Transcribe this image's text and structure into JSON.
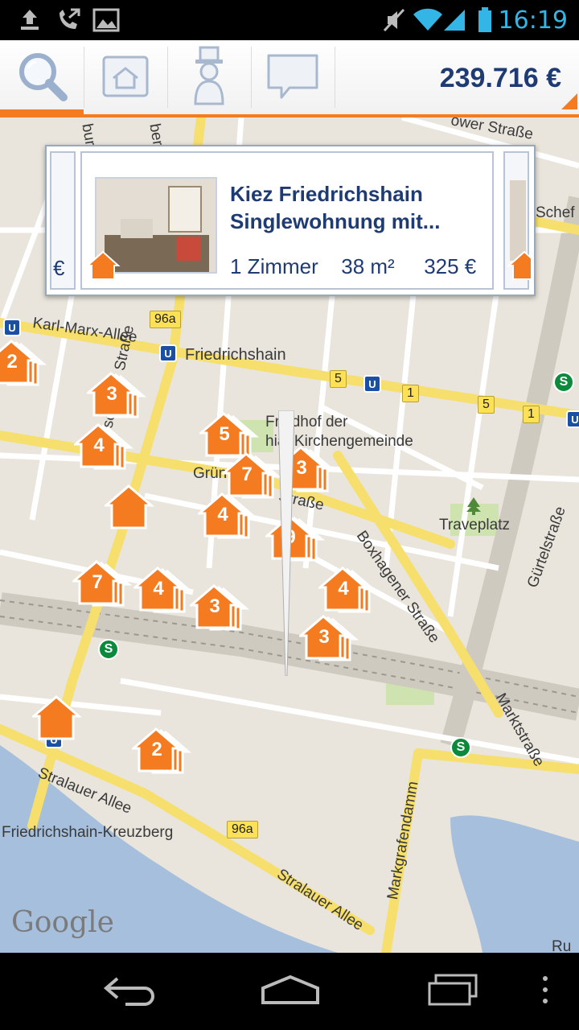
{
  "status_bar": {
    "time": "16:19",
    "icons": [
      "upload-icon",
      "call-forward-icon",
      "image-icon",
      "mute-icon",
      "wifi-icon",
      "signal-icon",
      "battery-icon"
    ]
  },
  "toolbar": {
    "tabs": [
      {
        "name": "search",
        "icon": "search-icon",
        "active": true
      },
      {
        "name": "saved",
        "icon": "house-folder-icon"
      },
      {
        "name": "agent",
        "icon": "butler-icon"
      },
      {
        "name": "messages",
        "icon": "speech-bubble-icon"
      }
    ],
    "budget": "239.716 €",
    "accent_color": "#f47b20",
    "text_color": "#1f3b73"
  },
  "popup": {
    "title": "Kiez Friedrichshain Singlewohnung mit...",
    "rooms": "1 Zimmer",
    "area": "38 m²",
    "price": "325 €",
    "left_peek_text": "€",
    "right_peek_text": ""
  },
  "map": {
    "labels": {
      "karl_marx": "Karl-Marx-Allee",
      "friedrichshain": "Friedrichshain",
      "friedhof1": "Friedhof der",
      "friedhof2": "hial-Kirchengemeinde",
      "warschauer": "arschauer Straße",
      "gruen": "Grün",
      "strasse": "Straße",
      "boxhagener": "Boxhagener Straße",
      "traveplatz": "Traveplatz",
      "guertel": "Gürtelstraße",
      "markt": "Marktstraße",
      "stralauer1": "Stralauer Allee",
      "stralauer2": "Stralauer Allee",
      "fk": "Friedrichshain-Kreuzberg",
      "markgrafen": "Markgrafendamm",
      "wer": "ower Straße",
      "schef": "Schef",
      "bur": "bur",
      "ber": "ber",
      "ru": "Ru",
      "google": "Google"
    },
    "road_badges": {
      "b96a_top": "96a",
      "b96a_bottom": "96a",
      "b5a": "5",
      "b5b": "5",
      "b1a": "1",
      "b1b": "1"
    },
    "markers": [
      {
        "id": "m1",
        "count": "2"
      },
      {
        "id": "m2",
        "count": "3"
      },
      {
        "id": "m3",
        "count": "4"
      },
      {
        "id": "m4",
        "count": ""
      },
      {
        "id": "m5",
        "count": "5"
      },
      {
        "id": "m6",
        "count": "7"
      },
      {
        "id": "m7",
        "count": "3"
      },
      {
        "id": "m8",
        "count": "4"
      },
      {
        "id": "m9",
        "count": "9"
      },
      {
        "id": "m10",
        "count": "7"
      },
      {
        "id": "m11",
        "count": "4"
      },
      {
        "id": "m12",
        "count": "3"
      },
      {
        "id": "m13",
        "count": "4"
      },
      {
        "id": "m14",
        "count": "3"
      },
      {
        "id": "m15",
        "count": ""
      },
      {
        "id": "m16",
        "count": "2"
      }
    ],
    "marker_color": "#f47b20"
  },
  "nav_bar": {
    "buttons": [
      "back-icon",
      "home-icon",
      "recent-apps-icon",
      "overflow-menu-icon"
    ]
  }
}
